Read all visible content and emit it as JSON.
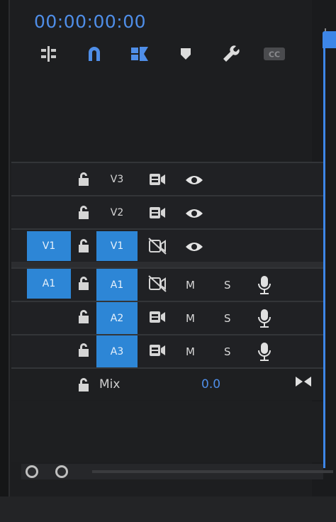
{
  "timecode": "00:00:00:00",
  "toolbar": {
    "tools": [
      {
        "name": "insert-sequence-nested-icon"
      },
      {
        "name": "snap-icon"
      },
      {
        "name": "linked-selection-icon"
      },
      {
        "name": "add-marker-icon"
      },
      {
        "name": "timeline-settings-wrench-icon"
      },
      {
        "name": "captions-icon",
        "label": "CC"
      }
    ]
  },
  "tracks": {
    "video": [
      {
        "source": "",
        "target": "V3"
      },
      {
        "source": "",
        "target": "V2"
      },
      {
        "source": "V1",
        "target": "V1"
      }
    ],
    "audio": [
      {
        "source": "A1",
        "target": "A1",
        "mute": "M",
        "solo": "S"
      },
      {
        "source": "",
        "target": "A2",
        "mute": "M",
        "solo": "S"
      },
      {
        "source": "",
        "target": "A3",
        "mute": "M",
        "solo": "S"
      }
    ],
    "mix": {
      "label": "Mix",
      "value": "0.0"
    }
  },
  "colors": {
    "accent": "#2d86d6",
    "timecode": "#4f8ee8",
    "playhead": "#3d86e8"
  }
}
